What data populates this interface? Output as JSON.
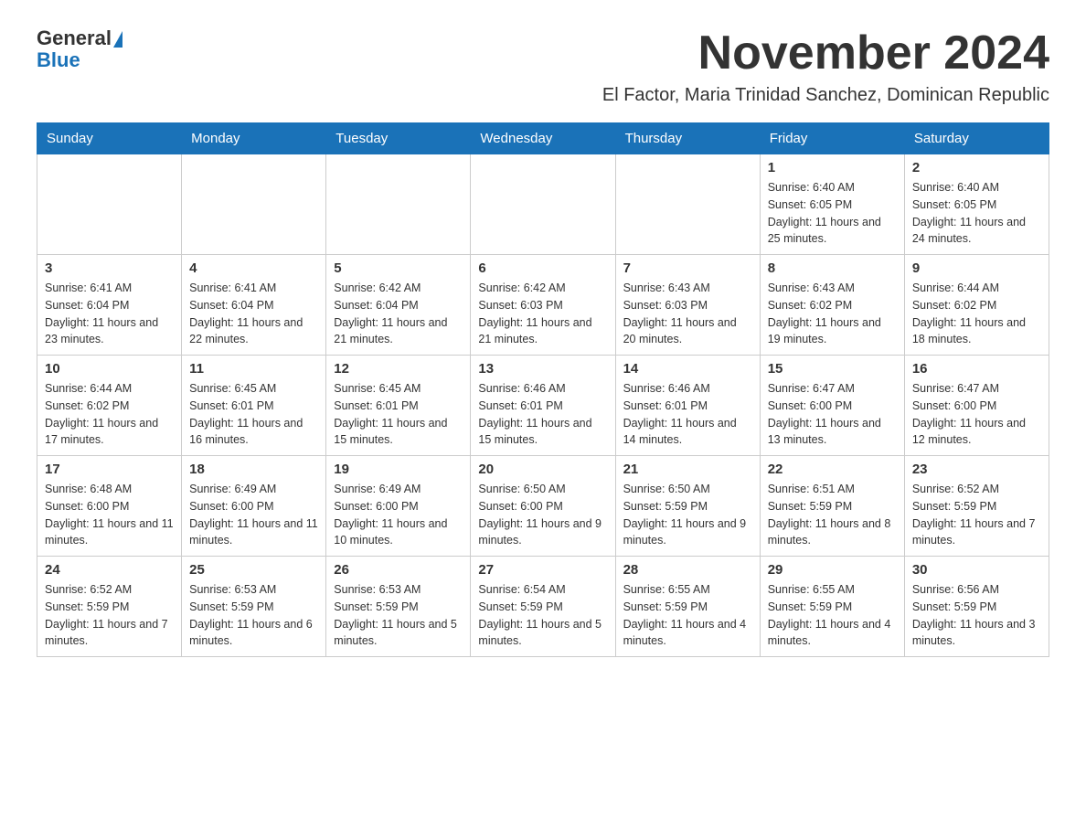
{
  "header": {
    "logo_general": "General",
    "logo_blue": "Blue",
    "month_title": "November 2024",
    "location": "El Factor, Maria Trinidad Sanchez, Dominican Republic"
  },
  "weekdays": [
    "Sunday",
    "Monday",
    "Tuesday",
    "Wednesday",
    "Thursday",
    "Friday",
    "Saturday"
  ],
  "weeks": [
    [
      {
        "day": "",
        "info": ""
      },
      {
        "day": "",
        "info": ""
      },
      {
        "day": "",
        "info": ""
      },
      {
        "day": "",
        "info": ""
      },
      {
        "day": "",
        "info": ""
      },
      {
        "day": "1",
        "info": "Sunrise: 6:40 AM\nSunset: 6:05 PM\nDaylight: 11 hours and 25 minutes."
      },
      {
        "day": "2",
        "info": "Sunrise: 6:40 AM\nSunset: 6:05 PM\nDaylight: 11 hours and 24 minutes."
      }
    ],
    [
      {
        "day": "3",
        "info": "Sunrise: 6:41 AM\nSunset: 6:04 PM\nDaylight: 11 hours and 23 minutes."
      },
      {
        "day": "4",
        "info": "Sunrise: 6:41 AM\nSunset: 6:04 PM\nDaylight: 11 hours and 22 minutes."
      },
      {
        "day": "5",
        "info": "Sunrise: 6:42 AM\nSunset: 6:04 PM\nDaylight: 11 hours and 21 minutes."
      },
      {
        "day": "6",
        "info": "Sunrise: 6:42 AM\nSunset: 6:03 PM\nDaylight: 11 hours and 21 minutes."
      },
      {
        "day": "7",
        "info": "Sunrise: 6:43 AM\nSunset: 6:03 PM\nDaylight: 11 hours and 20 minutes."
      },
      {
        "day": "8",
        "info": "Sunrise: 6:43 AM\nSunset: 6:02 PM\nDaylight: 11 hours and 19 minutes."
      },
      {
        "day": "9",
        "info": "Sunrise: 6:44 AM\nSunset: 6:02 PM\nDaylight: 11 hours and 18 minutes."
      }
    ],
    [
      {
        "day": "10",
        "info": "Sunrise: 6:44 AM\nSunset: 6:02 PM\nDaylight: 11 hours and 17 minutes."
      },
      {
        "day": "11",
        "info": "Sunrise: 6:45 AM\nSunset: 6:01 PM\nDaylight: 11 hours and 16 minutes."
      },
      {
        "day": "12",
        "info": "Sunrise: 6:45 AM\nSunset: 6:01 PM\nDaylight: 11 hours and 15 minutes."
      },
      {
        "day": "13",
        "info": "Sunrise: 6:46 AM\nSunset: 6:01 PM\nDaylight: 11 hours and 15 minutes."
      },
      {
        "day": "14",
        "info": "Sunrise: 6:46 AM\nSunset: 6:01 PM\nDaylight: 11 hours and 14 minutes."
      },
      {
        "day": "15",
        "info": "Sunrise: 6:47 AM\nSunset: 6:00 PM\nDaylight: 11 hours and 13 minutes."
      },
      {
        "day": "16",
        "info": "Sunrise: 6:47 AM\nSunset: 6:00 PM\nDaylight: 11 hours and 12 minutes."
      }
    ],
    [
      {
        "day": "17",
        "info": "Sunrise: 6:48 AM\nSunset: 6:00 PM\nDaylight: 11 hours and 11 minutes."
      },
      {
        "day": "18",
        "info": "Sunrise: 6:49 AM\nSunset: 6:00 PM\nDaylight: 11 hours and 11 minutes."
      },
      {
        "day": "19",
        "info": "Sunrise: 6:49 AM\nSunset: 6:00 PM\nDaylight: 11 hours and 10 minutes."
      },
      {
        "day": "20",
        "info": "Sunrise: 6:50 AM\nSunset: 6:00 PM\nDaylight: 11 hours and 9 minutes."
      },
      {
        "day": "21",
        "info": "Sunrise: 6:50 AM\nSunset: 5:59 PM\nDaylight: 11 hours and 9 minutes."
      },
      {
        "day": "22",
        "info": "Sunrise: 6:51 AM\nSunset: 5:59 PM\nDaylight: 11 hours and 8 minutes."
      },
      {
        "day": "23",
        "info": "Sunrise: 6:52 AM\nSunset: 5:59 PM\nDaylight: 11 hours and 7 minutes."
      }
    ],
    [
      {
        "day": "24",
        "info": "Sunrise: 6:52 AM\nSunset: 5:59 PM\nDaylight: 11 hours and 7 minutes."
      },
      {
        "day": "25",
        "info": "Sunrise: 6:53 AM\nSunset: 5:59 PM\nDaylight: 11 hours and 6 minutes."
      },
      {
        "day": "26",
        "info": "Sunrise: 6:53 AM\nSunset: 5:59 PM\nDaylight: 11 hours and 5 minutes."
      },
      {
        "day": "27",
        "info": "Sunrise: 6:54 AM\nSunset: 5:59 PM\nDaylight: 11 hours and 5 minutes."
      },
      {
        "day": "28",
        "info": "Sunrise: 6:55 AM\nSunset: 5:59 PM\nDaylight: 11 hours and 4 minutes."
      },
      {
        "day": "29",
        "info": "Sunrise: 6:55 AM\nSunset: 5:59 PM\nDaylight: 11 hours and 4 minutes."
      },
      {
        "day": "30",
        "info": "Sunrise: 6:56 AM\nSunset: 5:59 PM\nDaylight: 11 hours and 3 minutes."
      }
    ]
  ]
}
